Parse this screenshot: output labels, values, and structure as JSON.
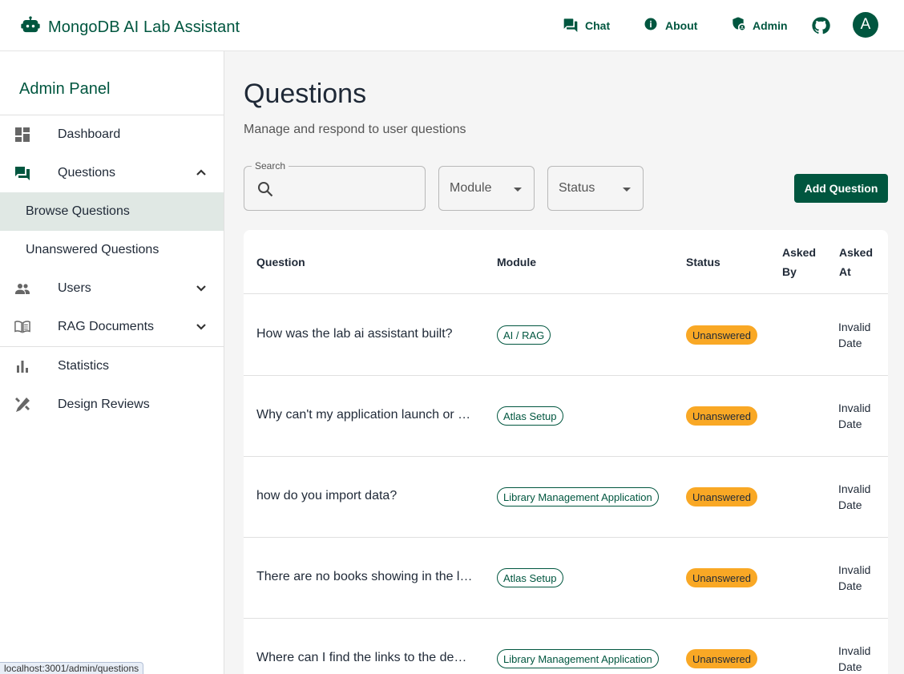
{
  "app": {
    "title": "MongoDB AI Lab Assistant",
    "brand_color": "#00563f",
    "logo_icon": "robot-icon"
  },
  "header": {
    "nav": [
      {
        "label": "Chat",
        "icon": "chat-icon"
      },
      {
        "label": "About",
        "icon": "info-icon"
      },
      {
        "label": "Admin",
        "icon": "admin-shield-icon"
      }
    ],
    "github_icon": "github-icon",
    "avatar_initial": "A"
  },
  "sidebar": {
    "title": "Admin Panel",
    "items": [
      {
        "label": "Dashboard",
        "icon": "dashboard-icon"
      },
      {
        "label": "Questions",
        "icon": "forum-icon",
        "expanded": true
      },
      {
        "label": "Browse Questions",
        "active": true
      },
      {
        "label": "Unanswered Questions"
      },
      {
        "label": "Users",
        "icon": "people-icon",
        "expanded": false
      },
      {
        "label": "RAG Documents",
        "icon": "book-icon",
        "expanded": false
      },
      {
        "label": "Statistics",
        "icon": "bar-chart-icon"
      },
      {
        "label": "Design Reviews",
        "icon": "design-tools-icon"
      }
    ]
  },
  "main": {
    "title": "Questions",
    "subtitle": "Manage and respond to user questions",
    "search": {
      "label": "Search",
      "value": ""
    },
    "filters": {
      "module": "Module",
      "status": "Status"
    },
    "add_button": "Add Question"
  },
  "table": {
    "headers": {
      "question": "Question",
      "module": "Module",
      "status": "Status",
      "asked_by_1": "Asked",
      "asked_by_2": "By",
      "asked_at_1": "Asked",
      "asked_at_2": "At"
    },
    "rows": [
      {
        "question": "How was the lab ai assistant built?",
        "module": "AI / RAG",
        "status": "Unanswered",
        "asked_by": "",
        "asked_at_1": "Invalid",
        "asked_at_2": "Date"
      },
      {
        "question": "Why can't my application launch or …",
        "module": "Atlas Setup",
        "status": "Unanswered",
        "asked_by": "",
        "asked_at_1": "Invalid",
        "asked_at_2": "Date"
      },
      {
        "question": "how do you import data?",
        "module": "Library Management Application",
        "status": "Unanswered",
        "asked_by": "",
        "asked_at_1": "Invalid",
        "asked_at_2": "Date"
      },
      {
        "question": "There are no books showing in the li…",
        "module": "Atlas Setup",
        "status": "Unanswered",
        "asked_by": "",
        "asked_at_1": "Invalid",
        "asked_at_2": "Date"
      },
      {
        "question": "Where can I find the links to the dev…",
        "module": "Library Management Application",
        "status": "Unanswered",
        "asked_by": "",
        "asked_at_1": "Invalid",
        "asked_at_2": "Date"
      }
    ],
    "status_color": "#f9a825"
  },
  "browser": {
    "status_url": "localhost:3001/admin/questions"
  }
}
